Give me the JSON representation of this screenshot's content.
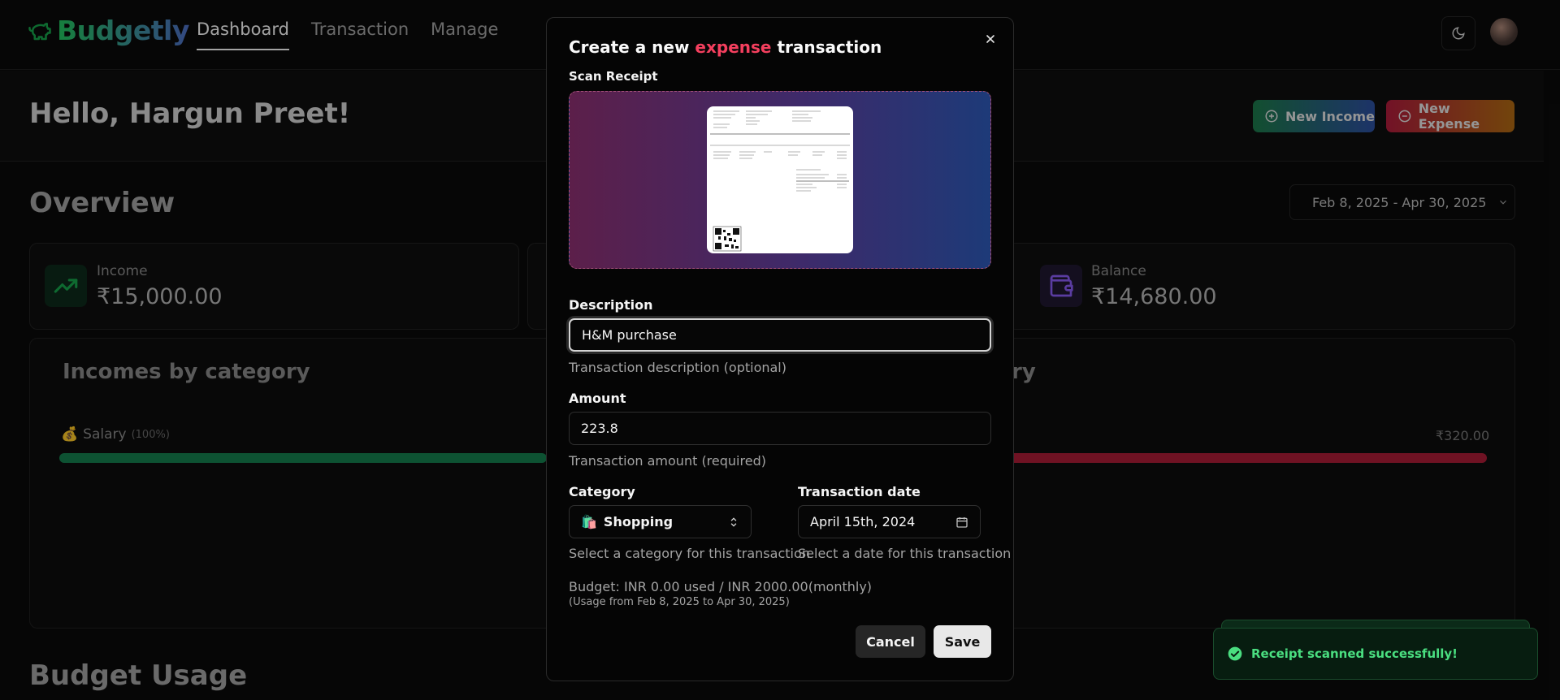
{
  "app": {
    "name": "Budgetly"
  },
  "nav": {
    "links": [
      "Dashboard",
      "Transaction",
      "Manage"
    ],
    "active": "Dashboard"
  },
  "header": {
    "greeting": "Hello, Hargun Preet!",
    "new_income_label": "New Income",
    "new_expense_label": "New Expense"
  },
  "overview": {
    "title": "Overview",
    "date_range": "Feb 8, 2025 - Apr 30, 2025",
    "cards": {
      "income": {
        "label": "Income",
        "value": "₹15,000.00"
      },
      "balance": {
        "label": "Balance",
        "value": "₹14,680.00"
      }
    },
    "incomes_title": "Incomes by category",
    "expenses_title_fragment": "ry",
    "income_row": {
      "emoji": "💰",
      "label": "Salary",
      "pct": "(100%)"
    },
    "expense_value": "₹320.00"
  },
  "budget_usage_title": "Budget Usage",
  "modal": {
    "title_prefix": "Create a new",
    "title_type": "expense",
    "title_suffix": "transaction",
    "scan_label": "Scan Receipt",
    "description_label": "Description",
    "description_value": "H&M purchase",
    "description_help": "Transaction description (optional)",
    "amount_label": "Amount",
    "amount_value": "223.8",
    "amount_help": "Transaction amount (required)",
    "category_label": "Category",
    "category_emoji": "🛍️",
    "category_value": "Shopping",
    "category_help": "Select a category for this transaction",
    "date_label": "Transaction date",
    "date_value": "April 15th, 2024",
    "date_help": "Select a date for this transaction",
    "budget_line": "Budget: INR 0.00 used / INR 2000.00(monthly)",
    "budget_range": "(Usage from Feb 8, 2025 to Apr 30, 2025)",
    "cancel_label": "Cancel",
    "save_label": "Save"
  },
  "toast": {
    "message": "Receipt scanned successfully!"
  },
  "colors": {
    "expense_accent": "#f43f5e",
    "income_bar": "#16935a",
    "expense_bar": "#c8203f",
    "toast_text": "#4ade80"
  }
}
